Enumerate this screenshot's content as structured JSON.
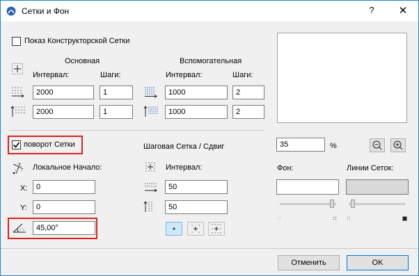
{
  "window": {
    "title": "Сетки и Фон",
    "help_label": "?",
    "close_label": "✕"
  },
  "construction_grid": {
    "checkbox_label": "Показ Конструкторской Сетки",
    "checked": false,
    "main_header": "Основная",
    "aux_header": "Вспомогательная",
    "interval_label": "Интервал:",
    "steps_label": "Шаги:",
    "main": {
      "x_interval": "2000",
      "x_steps": "1",
      "y_interval": "2000",
      "y_steps": "1"
    },
    "aux": {
      "x_interval": "1000",
      "x_steps": "2",
      "y_interval": "1000",
      "y_steps": "2"
    }
  },
  "rotated_grid": {
    "checkbox_label": "поворот Сетки",
    "checked": true,
    "origin_label": "Локальное Начало:",
    "x_label": "X:",
    "x_value": "0",
    "y_label": "Y:",
    "y_value": "0",
    "angle_value": "45,00°"
  },
  "snap_grid": {
    "header": "Шаговая Сетка / Сдвиг",
    "interval_label": "Интервал:",
    "x_value": "50",
    "y_value": "50"
  },
  "view": {
    "zoom_value": "35",
    "zoom_unit": "%",
    "background_label": "Фон:",
    "grid_lines_label": "Линии Сеток:",
    "background_color": "#ffffff",
    "grid_lines_color": "#d9d9d9"
  },
  "buttons": {
    "cancel": "Отменить",
    "ok": "OK"
  }
}
